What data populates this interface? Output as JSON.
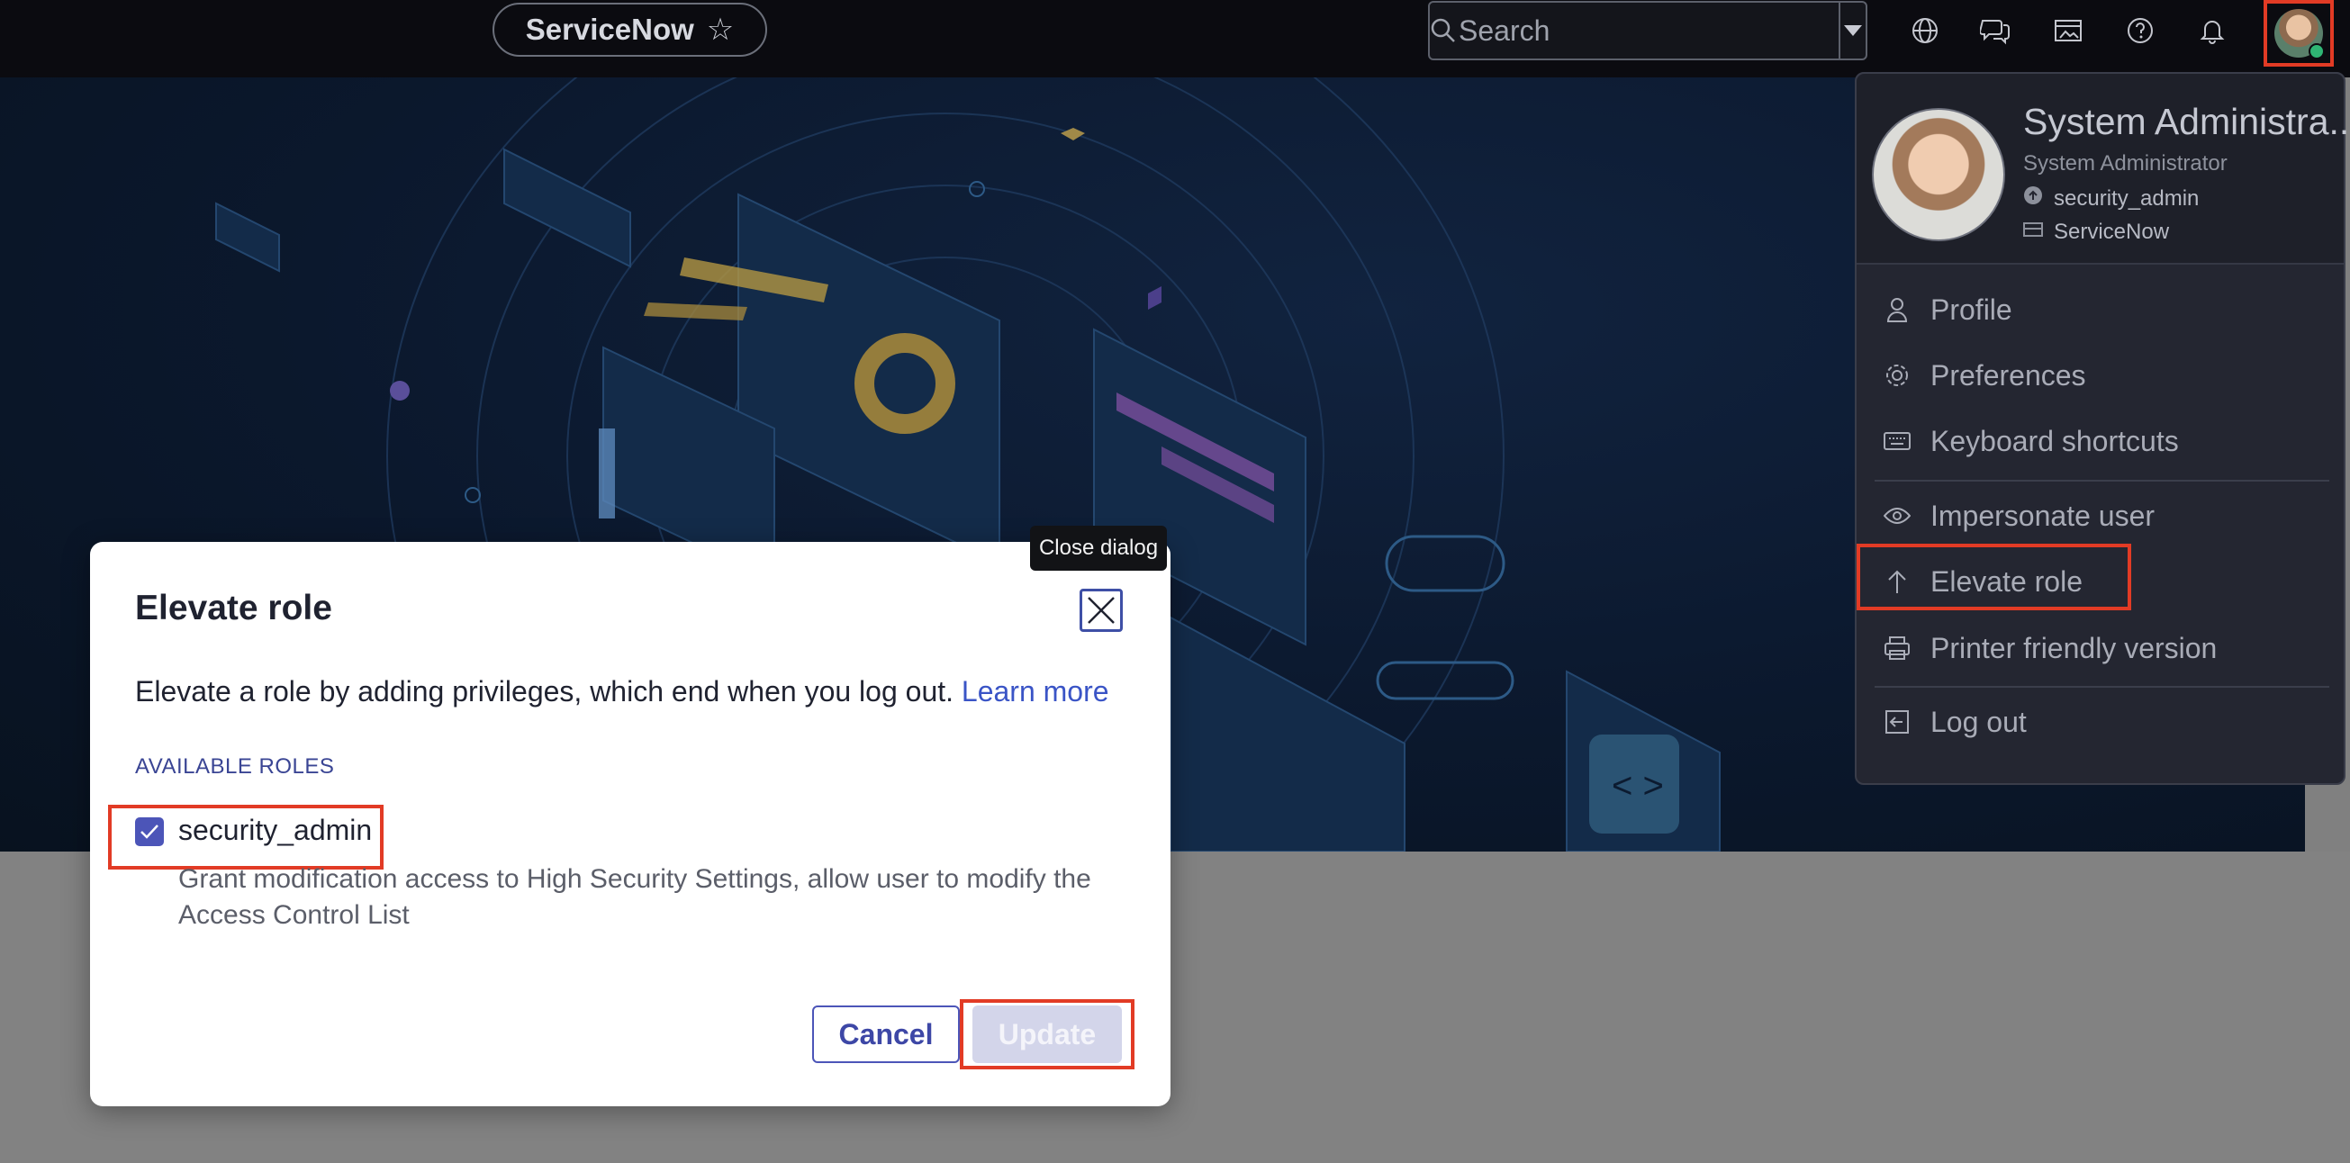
{
  "topbar": {
    "app_name": "ServiceNow",
    "star_icon": "star-icon",
    "search": {
      "placeholder": "Search"
    },
    "icons": [
      "globe-icon",
      "chat-icon",
      "showcase-icon",
      "help-icon",
      "bell-icon"
    ]
  },
  "user_menu": {
    "name": "System Administra...",
    "title": "System Administrator",
    "elevated_role": "security_admin",
    "instance": "ServiceNow",
    "items": [
      {
        "label": "Profile",
        "icon": "person-icon"
      },
      {
        "label": "Preferences",
        "icon": "gear-icon"
      },
      {
        "label": "Keyboard shortcuts",
        "icon": "keyboard-icon"
      },
      {
        "label": "Impersonate user",
        "icon": "eye-icon"
      },
      {
        "label": "Elevate role",
        "icon": "arrow-up-icon"
      },
      {
        "label": "Printer friendly version",
        "icon": "printer-icon"
      },
      {
        "label": "Log out",
        "icon": "logout-icon"
      }
    ]
  },
  "dialog": {
    "title": "Elevate role",
    "close_tooltip": "Close dialog",
    "description": "Elevate a role by adding privileges, which end when you log out.",
    "learn_more": "Learn more",
    "roles_label": "AVAILABLE ROLES",
    "role": {
      "name": "security_admin",
      "checked": true,
      "description": "Grant modification access to High Security Settings, allow user to modify the Access Control List"
    },
    "cancel_label": "Cancel",
    "update_label": "Update"
  },
  "colors": {
    "highlight": "#e23b25",
    "accent": "#4c55b8",
    "link": "#3a54c6"
  }
}
